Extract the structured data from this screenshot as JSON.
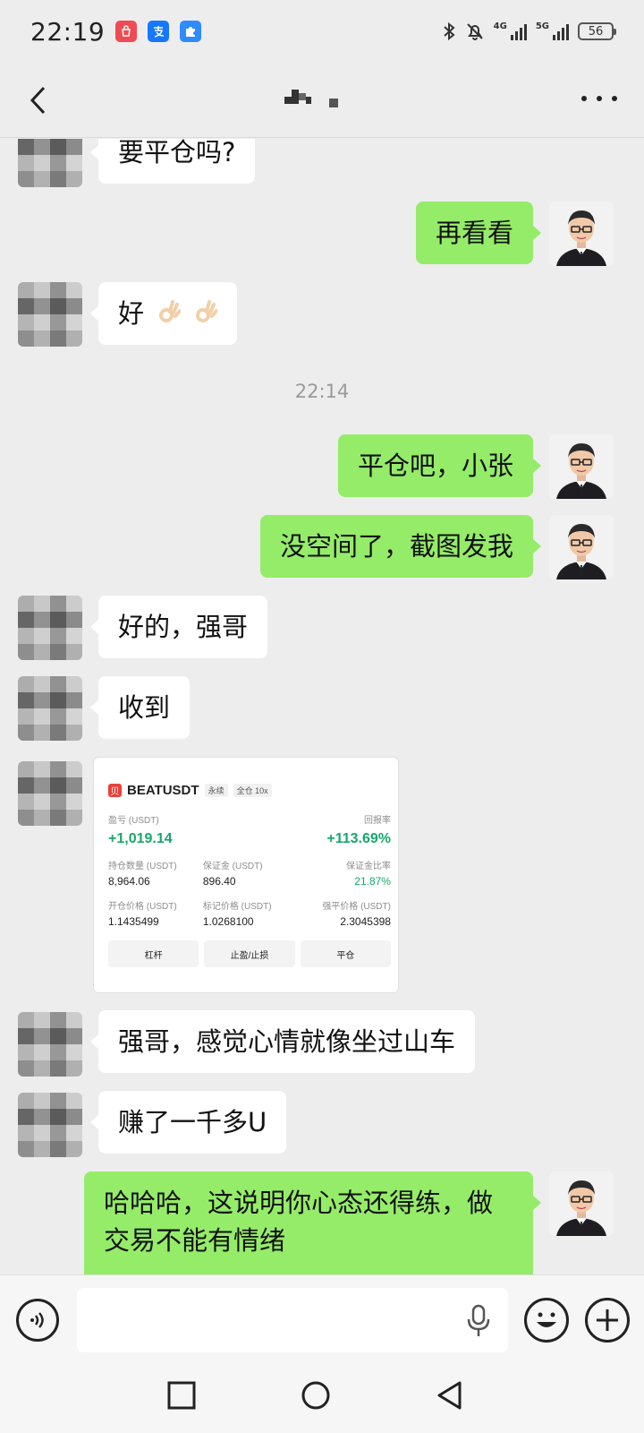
{
  "status_bar": {
    "time": "22:19",
    "net_tag_1": "4G",
    "net_tag_2": "5G",
    "battery": "56"
  },
  "header": {
    "title": ""
  },
  "messages": [
    {
      "side": "in",
      "text": "要平仓吗?"
    },
    {
      "side": "out",
      "text": "再看看"
    },
    {
      "side": "in",
      "text": "好"
    },
    {
      "type": "time",
      "text": "22:14"
    },
    {
      "side": "out",
      "text": "平仓吧，小张"
    },
    {
      "side": "out",
      "text": "没空间了，截图发我"
    },
    {
      "side": "in",
      "text": "好的，强哥"
    },
    {
      "side": "in",
      "text": "收到"
    },
    {
      "side": "in",
      "type": "image"
    },
    {
      "side": "in",
      "text": "强哥，感觉心情就像坐过山车"
    },
    {
      "side": "in",
      "text": "赚了一千多U"
    },
    {
      "side": "out",
      "text": "哈哈哈，这说明你心态还得练，做交易不能有情绪"
    }
  ],
  "trade_card": {
    "logo": "贝",
    "symbol": "BEATUSDT",
    "tag_perp": "永续",
    "tag_margin": "全仓 10x",
    "pnl_label": "盈亏 (USDT)",
    "roi_label": "回报率",
    "pnl_value": "+1,019.14",
    "roi_value": "+113.69%",
    "size_label": "持仓数量 (USDT)",
    "margin_label": "保证金 (USDT)",
    "margin_ratio_label": "保证金比率",
    "size_value": "8,964.06",
    "margin_value": "896.40",
    "margin_ratio_value": "21.87%",
    "entry_label": "开仓价格 (USDT)",
    "mark_label": "标记价格 (USDT)",
    "liq_label": "强平价格 (USDT)",
    "entry_value": "1.1435499",
    "mark_value": "1.0268100",
    "liq_value": "2.3045398",
    "btn_leverage": "杠杆",
    "btn_tpsl": "止盈/止损",
    "btn_close": "平仓"
  },
  "input": {
    "placeholder": ""
  },
  "icons": {
    "back": "chevron-left-icon",
    "more": "more-dots-icon",
    "voice": "voice-icon",
    "mic": "microphone-icon",
    "emoji": "emoji-icon",
    "plus": "plus-icon"
  },
  "colors": {
    "outgoing_bubble": "#95ec69",
    "incoming_bubble": "#ffffff",
    "background": "#ededed",
    "profit_green": "#17a86b"
  }
}
